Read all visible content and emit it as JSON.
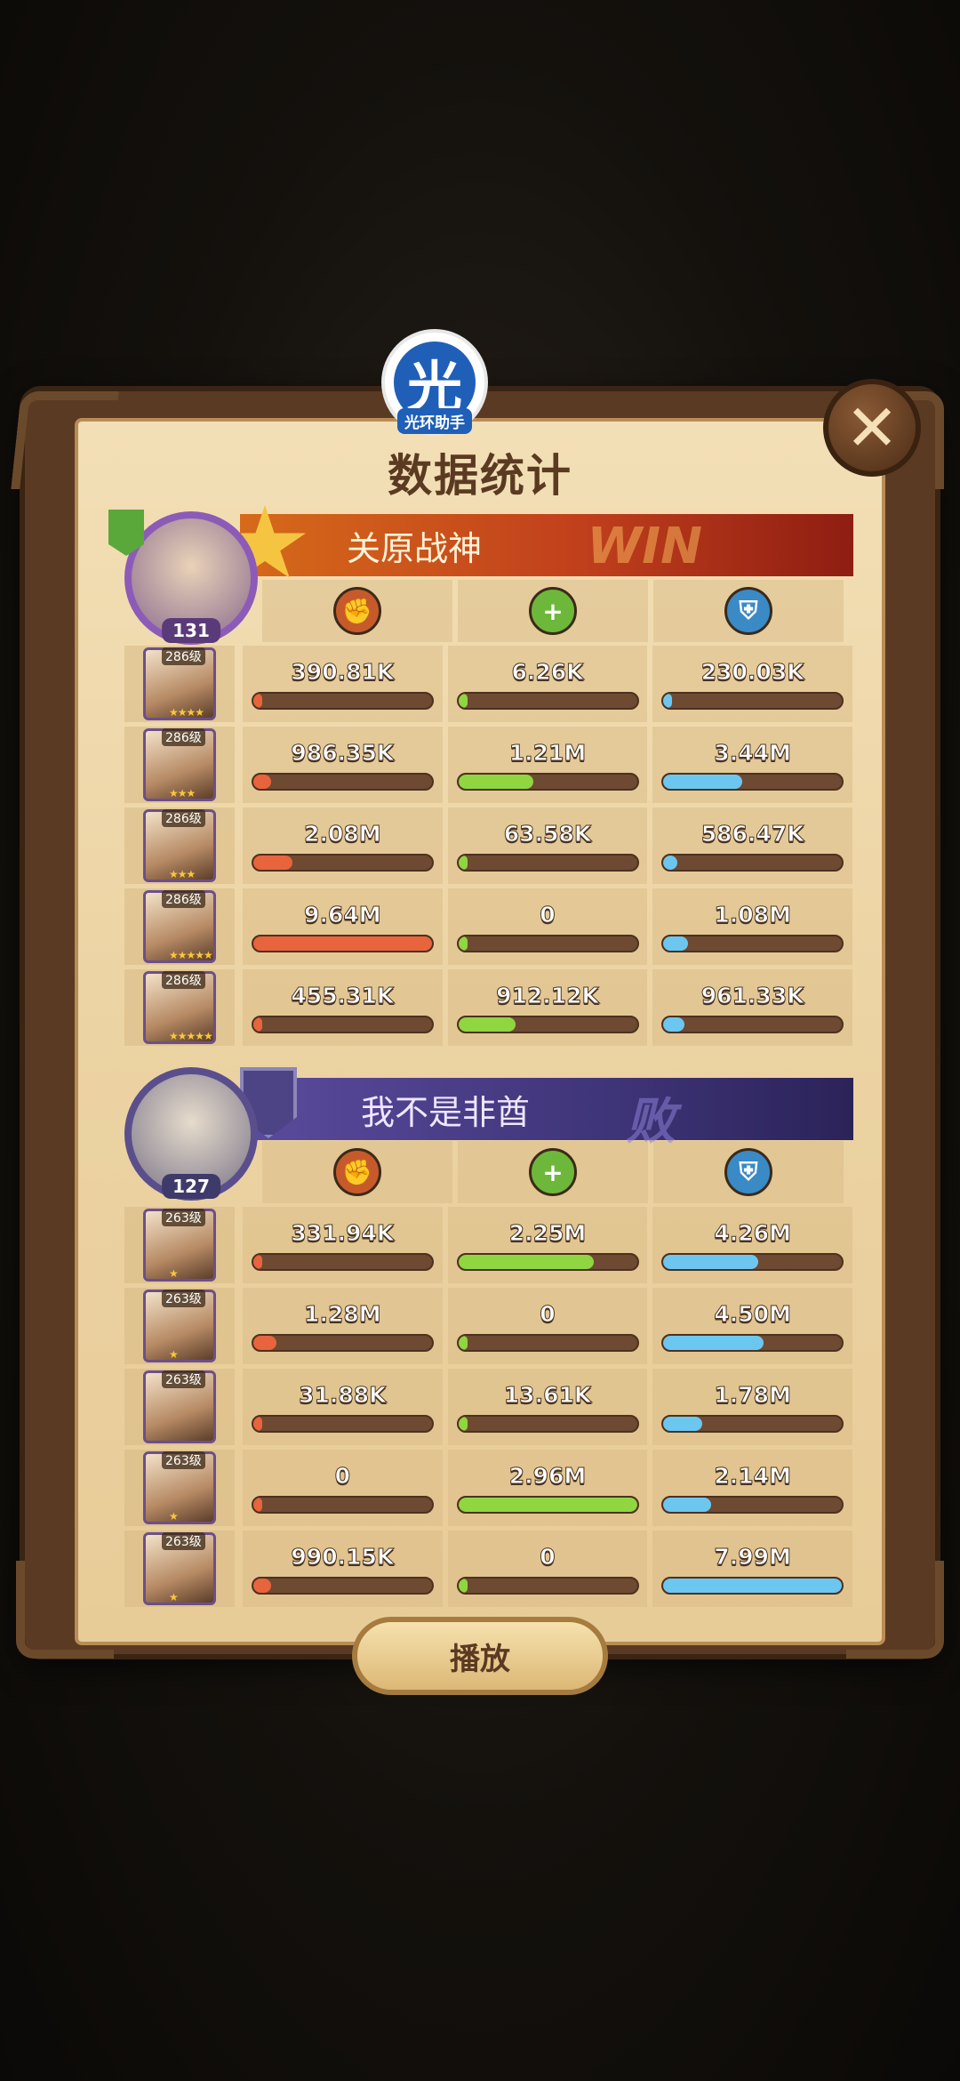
{
  "app_badge": {
    "glyph": "光",
    "label": "光环助手"
  },
  "close": {
    "label": "✕"
  },
  "title": "数据统计",
  "team1": {
    "name": "关原战神",
    "result": "WIN",
    "level": "131",
    "icons": {
      "attack": "attack-icon",
      "heal": "heal-icon",
      "defense": "defense-icon"
    },
    "heroes": [
      {
        "tag": "286级",
        "stars": "★★★★",
        "damage": "390.81K",
        "damage_pct": 0.04,
        "heal": "6.26K",
        "heal_pct": 0.0,
        "tank": "230.03K",
        "tank_pct": 0.03
      },
      {
        "tag": "286级",
        "stars": "★★★",
        "damage": "986.35K",
        "damage_pct": 0.1,
        "heal": "1.21M",
        "heal_pct": 0.42,
        "tank": "3.44M",
        "tank_pct": 0.44
      },
      {
        "tag": "286级",
        "stars": "★★★",
        "damage": "2.08M",
        "damage_pct": 0.22,
        "heal": "63.58K",
        "heal_pct": 0.04,
        "tank": "586.47K",
        "tank_pct": 0.08
      },
      {
        "tag": "286级",
        "stars": "★★★★★",
        "damage": "9.64M",
        "damage_pct": 1.0,
        "heal": "0",
        "heal_pct": 0.0,
        "tank": "1.08M",
        "tank_pct": 0.14
      },
      {
        "tag": "286级",
        "stars": "★★★★★",
        "damage": "455.31K",
        "damage_pct": 0.05,
        "heal": "912.12K",
        "heal_pct": 0.32,
        "tank": "961.33K",
        "tank_pct": 0.12
      }
    ]
  },
  "team2": {
    "name": "我不是非酋",
    "result": "败",
    "level": "127",
    "heroes": [
      {
        "tag": "263级",
        "stars": "★",
        "damage": "331.94K",
        "damage_pct": 0.03,
        "heal": "2.25M",
        "heal_pct": 0.76,
        "tank": "4.26M",
        "tank_pct": 0.53
      },
      {
        "tag": "263级",
        "stars": "★",
        "damage": "1.28M",
        "damage_pct": 0.13,
        "heal": "0",
        "heal_pct": 0.0,
        "tank": "4.50M",
        "tank_pct": 0.56
      },
      {
        "tag": "263级",
        "stars": "",
        "damage": "31.88K",
        "damage_pct": 0.0,
        "heal": "13.61K",
        "heal_pct": 0.0,
        "tank": "1.78M",
        "tank_pct": 0.22
      },
      {
        "tag": "263级",
        "stars": "★",
        "damage": "0",
        "damage_pct": 0.0,
        "heal": "2.96M",
        "heal_pct": 1.0,
        "tank": "2.14M",
        "tank_pct": 0.27
      },
      {
        "tag": "263级",
        "stars": "★",
        "damage": "990.15K",
        "damage_pct": 0.1,
        "heal": "0",
        "heal_pct": 0.0,
        "tank": "7.99M",
        "tank_pct": 1.0
      }
    ]
  },
  "play_button": "播放"
}
